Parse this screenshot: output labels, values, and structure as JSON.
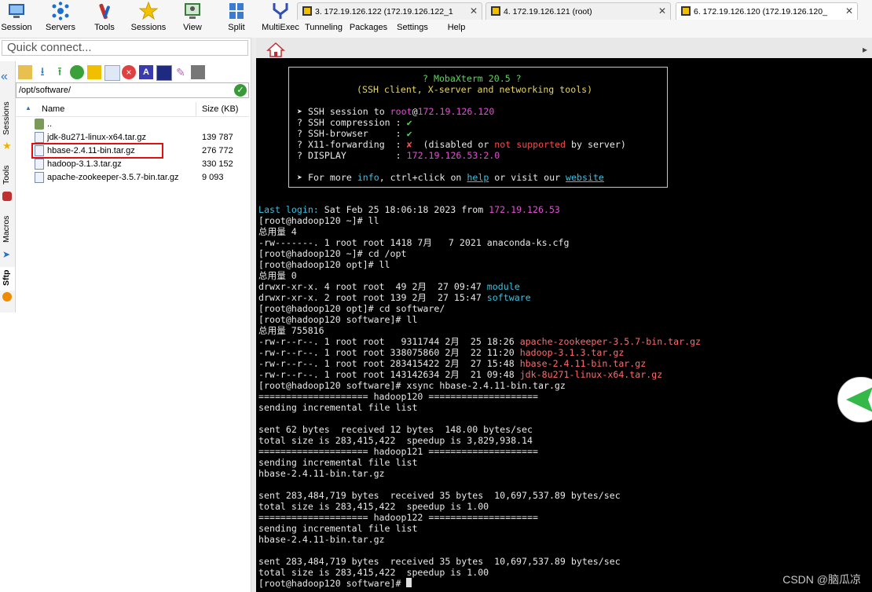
{
  "toolbar": [
    {
      "label": "Session",
      "icon": "session-icon"
    },
    {
      "label": "Servers",
      "icon": "servers-icon"
    },
    {
      "label": "Tools",
      "icon": "tools-icon"
    },
    {
      "label": "Sessions",
      "icon": "star-icon"
    },
    {
      "label": "View",
      "icon": "view-icon"
    },
    {
      "label": "Split",
      "icon": "split-icon"
    },
    {
      "label": "MultiExec",
      "icon": "multiexec-icon"
    },
    {
      "label": "Tunneling",
      "icon": "tunneling-icon"
    },
    {
      "label": "Packages",
      "icon": "packages-icon"
    },
    {
      "label": "Settings",
      "icon": "settings-icon"
    },
    {
      "label": "Help",
      "icon": "help-icon"
    }
  ],
  "quick_connect": {
    "placeholder": "Quick connect..."
  },
  "side_tabs": [
    "Sessions",
    "Tools",
    "Macros",
    "Sftp"
  ],
  "sftp": {
    "path": "/opt/software/",
    "columns": {
      "name": "Name",
      "size": "Size (KB)"
    },
    "files": [
      {
        "name": "..",
        "size": "",
        "type": "parent-folder"
      },
      {
        "name": "jdk-8u271-linux-x64.tar.gz",
        "size": "139 787",
        "type": "file"
      },
      {
        "name": "hbase-2.4.11-bin.tar.gz",
        "size": "276 772",
        "type": "file"
      },
      {
        "name": "hadoop-3.1.3.tar.gz",
        "size": "330 152",
        "type": "file"
      },
      {
        "name": "apache-zookeeper-3.5.7-bin.tar.gz",
        "size": "9 093",
        "type": "file"
      }
    ],
    "highlighted_file": "hbase-2.4.11-bin.tar.gz"
  },
  "tabs": [
    {
      "title": "3. 172.19.126.122 (172.19.126.122_1",
      "active": false
    },
    {
      "title": "4. 172.19.126.121 (root)",
      "active": false
    },
    {
      "title": "6. 172.19.126.120 (172.19.126.120_",
      "active": true
    }
  ],
  "banner": {
    "title": "? MobaXterm 20.5 ?",
    "subtitle": "(SSH client, X-server and networking tools)",
    "session_prefix": "➤ SSH session to ",
    "session_user": "root",
    "session_at": "@",
    "session_host": "172.19.126.120",
    "rows": [
      {
        "label": "? SSH compression : ",
        "value": "✔"
      },
      {
        "label": "? SSH-browser     : ",
        "value": "✔"
      },
      {
        "label": "? X11-forwarding  : ",
        "value": "✘",
        "note_a": "  (disabled or ",
        "note_b": "not supported",
        "note_c": " by server)"
      },
      {
        "label": "? DISPLAY         : ",
        "value": "172.19.126.53:2.0"
      }
    ],
    "footer_a": "➤ For more ",
    "footer_info": "info",
    "footer_b": ", ctrl+click on ",
    "footer_help": "help",
    "footer_c": " or visit our ",
    "footer_website": "website"
  },
  "terminal": {
    "last_login_label": "Last login:",
    "last_login_date": " Sat Feb 25 18:06:18 2023 from ",
    "last_login_ip": "172.19.126.53",
    "lines": [
      "[root@hadoop120 ~]# ll",
      "总用量 4",
      "-rw-------. 1 root root 1418 7月   7 2021 anaconda-ks.cfg",
      "[root@hadoop120 ~]# cd /opt",
      "[root@hadoop120 opt]# ll",
      "总用量 0"
    ],
    "dir_entries": [
      {
        "meta": "drwxr-xr-x. 4 root root  49 2月  27 09:47 ",
        "name": "module"
      },
      {
        "meta": "drwxr-xr-x. 2 root root 139 2月  27 15:47 ",
        "name": "software"
      }
    ],
    "lines2": [
      "[root@hadoop120 opt]# cd software/",
      "[root@hadoop120 software]# ll",
      "总用量 755816"
    ],
    "file_entries": [
      {
        "meta": "-rw-r--r--. 1 root root   9311744 2月  25 18:26 ",
        "name": "apache-zookeeper-3.5.7-bin.tar.gz"
      },
      {
        "meta": "-rw-r--r--. 1 root root 338075860 2月  22 11:20 ",
        "name": "hadoop-3.1.3.tar.gz"
      },
      {
        "meta": "-rw-r--r--. 1 root root 283415422 2月  27 15:48 ",
        "name": "hbase-2.4.11-bin.tar.gz"
      },
      {
        "meta": "-rw-r--r--. 1 root root 143142634 2月  21 09:48 ",
        "name": "jdk-8u271-linux-x64.tar.gz"
      }
    ],
    "lines3": [
      "[root@hadoop120 software]# xsync hbase-2.4.11-bin.tar.gz",
      "==================== hadoop120 ====================",
      "sending incremental file list",
      "",
      "sent 62 bytes  received 12 bytes  148.00 bytes/sec",
      "total size is 283,415,422  speedup is 3,829,938.14",
      "==================== hadoop121 ====================",
      "sending incremental file list",
      "hbase-2.4.11-bin.tar.gz",
      "",
      "sent 283,484,719 bytes  received 35 bytes  10,697,537.89 bytes/sec",
      "total size is 283,415,422  speedup is 1.00",
      "==================== hadoop122 ====================",
      "sending incremental file list",
      "hbase-2.4.11-bin.tar.gz",
      "",
      "sent 283,484,719 bytes  received 35 bytes  10,697,537.89 bytes/sec",
      "total size is 283,415,422  speedup is 1.00"
    ],
    "prompt": "[root@hadoop120 software]# "
  },
  "watermark": "CSDN @脑瓜凉",
  "colors": {
    "terminal_bg": "#000000",
    "highlight": "#e01010"
  }
}
